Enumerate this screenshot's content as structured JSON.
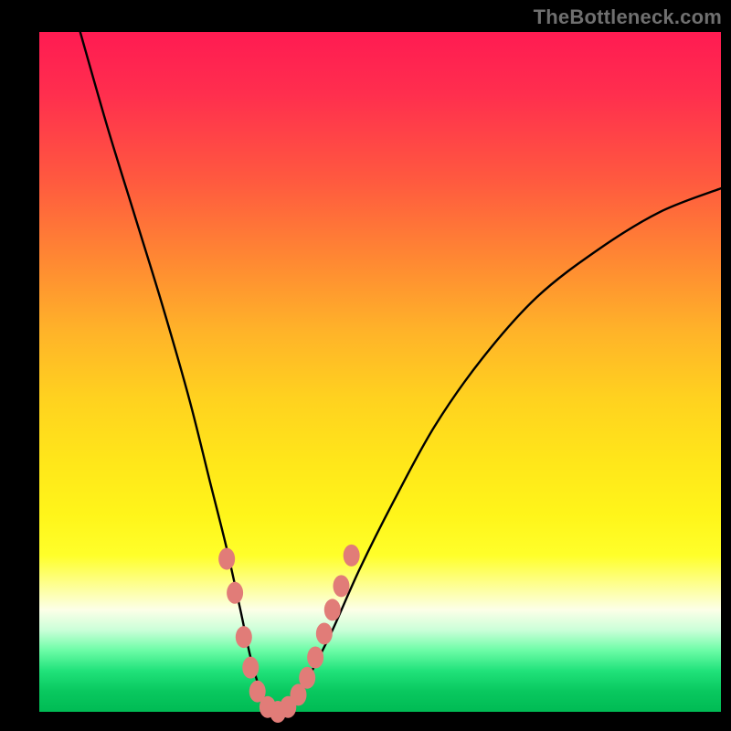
{
  "watermark": "TheBottleneck.com",
  "colors": {
    "background": "#000000",
    "curve": "#000000",
    "markers": "#e17c78",
    "gradient_top": "#ff1b52",
    "gradient_bottom": "#00bb54"
  },
  "chart_data": {
    "type": "line",
    "title": "",
    "xlabel": "",
    "ylabel": "",
    "xlim": [
      0,
      100
    ],
    "ylim": [
      0,
      100
    ],
    "grid": false,
    "legend": false,
    "series": [
      {
        "name": "bottleneck-curve",
        "x": [
          6,
          10,
          14,
          18,
          22,
          25,
          27.5,
          29.5,
          31,
          32.5,
          34,
          35,
          36,
          38,
          40,
          43,
          47,
          52,
          58,
          65,
          73,
          82,
          91,
          100
        ],
        "values": [
          100,
          86,
          73,
          60,
          46,
          34,
          24,
          15,
          8,
          3,
          0.5,
          0,
          0.5,
          2,
          6,
          12,
          21,
          31,
          42,
          52,
          61,
          68,
          73.5,
          77
        ]
      }
    ],
    "markers": {
      "name": "highlight-points",
      "x": [
        27.5,
        28.7,
        30.0,
        31.0,
        32.0,
        33.5,
        35.0,
        36.5,
        38.0,
        39.3,
        40.5,
        41.8,
        43.0,
        44.3,
        45.8
      ],
      "values": [
        22.5,
        17.5,
        11.0,
        6.5,
        3.0,
        0.7,
        0.0,
        0.7,
        2.5,
        5.0,
        8.0,
        11.5,
        15.0,
        18.5,
        23.0
      ]
    }
  }
}
